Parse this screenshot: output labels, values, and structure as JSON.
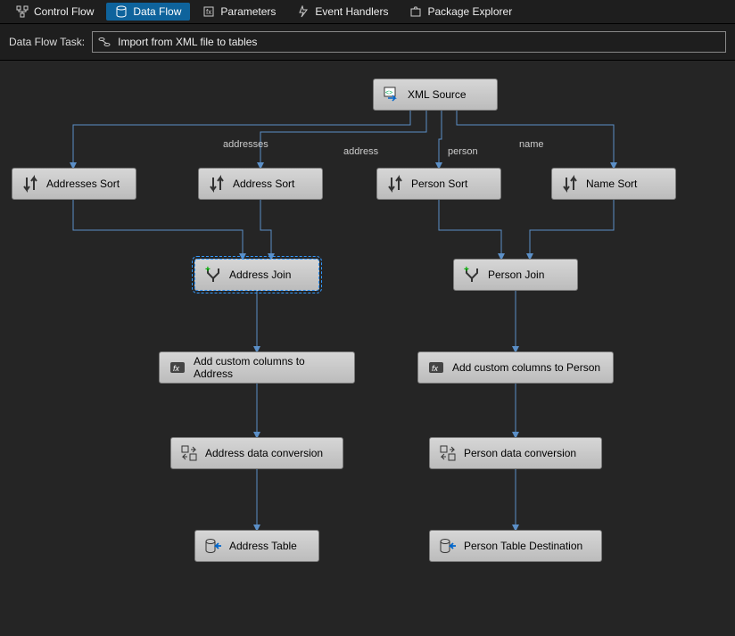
{
  "tabs": {
    "control_flow": "Control Flow",
    "data_flow": "Data Flow",
    "parameters": "Parameters",
    "event_handlers": "Event Handlers",
    "package_explorer": "Package Explorer"
  },
  "task_row": {
    "label": "Data Flow Task:",
    "selected": "Import from XML file to tables"
  },
  "edge_labels": {
    "addresses": "addresses",
    "address": "address",
    "person": "person",
    "name": "name"
  },
  "nodes": {
    "xml_source": "XML Source",
    "addresses_sort": "Addresses Sort",
    "address_sort": "Address Sort",
    "person_sort": "Person Sort",
    "name_sort": "Name Sort",
    "address_join": "Address Join",
    "person_join": "Person Join",
    "add_cols_address": "Add custom columns to Address",
    "add_cols_person": "Add custom columns to Person",
    "address_conv": "Address data conversion",
    "person_conv": "Person data conversion",
    "address_table": "Address Table",
    "person_table": "Person Table Destination"
  },
  "colors": {
    "accent": "#0e639c",
    "connector": "#5b8fc7"
  }
}
